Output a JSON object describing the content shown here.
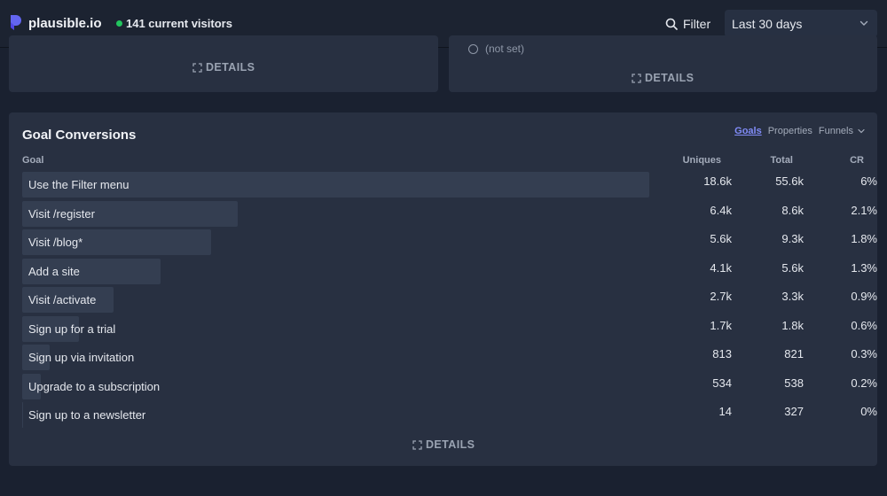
{
  "header": {
    "brand": "plausible.io",
    "visitors_text": "141 current visitors",
    "filter_label": "Filter",
    "date_range": "Last 30 days",
    "accent_color": "#818cf8",
    "live_color": "#22c55e"
  },
  "top_cards": {
    "left_details": "DETAILS",
    "right_notset": "(not set)",
    "right_details": "DETAILS"
  },
  "goal_card": {
    "title": "Goal Conversions",
    "tabs": [
      "Goals",
      "Properties",
      "Funnels"
    ],
    "active_tab": "Goals",
    "columns": {
      "goal": "Goal",
      "uniques": "Uniques",
      "total": "Total",
      "cr": "CR"
    },
    "rows": [
      {
        "goal": "Use the Filter menu",
        "uniques": "18.6k",
        "total": "55.6k",
        "cr": "6%",
        "bar_fraction": 1.0
      },
      {
        "goal": "Visit /register",
        "uniques": "6.4k",
        "total": "8.6k",
        "cr": "2.1%",
        "bar_fraction": 0.344
      },
      {
        "goal": "Visit /blog*",
        "uniques": "5.6k",
        "total": "9.3k",
        "cr": "1.8%",
        "bar_fraction": 0.301
      },
      {
        "goal": "Add a site",
        "uniques": "4.1k",
        "total": "5.6k",
        "cr": "1.3%",
        "bar_fraction": 0.22
      },
      {
        "goal": "Visit /activate",
        "uniques": "2.7k",
        "total": "3.3k",
        "cr": "0.9%",
        "bar_fraction": 0.145
      },
      {
        "goal": "Sign up for a trial",
        "uniques": "1.7k",
        "total": "1.8k",
        "cr": "0.6%",
        "bar_fraction": 0.091
      },
      {
        "goal": "Sign up via invitation",
        "uniques": "813",
        "total": "821",
        "cr": "0.3%",
        "bar_fraction": 0.044
      },
      {
        "goal": "Upgrade to a subscription",
        "uniques": "534",
        "total": "538",
        "cr": "0.2%",
        "bar_fraction": 0.029
      },
      {
        "goal": "Sign up to a newsletter",
        "uniques": "14",
        "total": "327",
        "cr": "0%",
        "bar_fraction": 0.001
      }
    ],
    "details": "DETAILS"
  }
}
